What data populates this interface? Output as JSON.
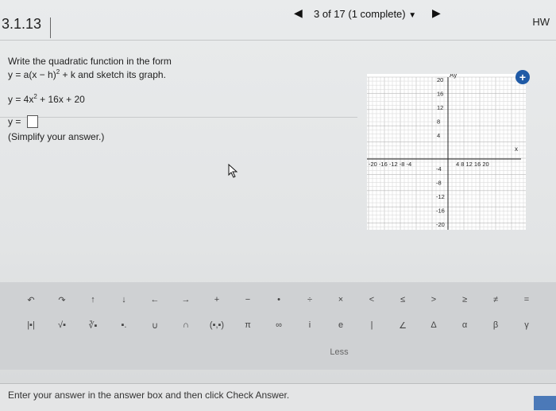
{
  "nav": {
    "prev_icon": "left-arrow",
    "status": "3 of 17 (1 complete)",
    "dropdown_icon": "triangle-down",
    "next_icon": "right-arrow",
    "hw": "HW"
  },
  "section_number": "3.1.13",
  "question": {
    "line1": "Write the quadratic function in the form",
    "line2_pre": "y = a(x − h)",
    "line2_sup": "2",
    "line2_post": " + k and sketch its graph.",
    "given_pre": "y = 4x",
    "given_sup": "2",
    "given_post": " + 16x + 20",
    "answer_prefix": "y =",
    "hint": "(Simplify your answer.)"
  },
  "graph": {
    "x_axis_label": "x",
    "y_axis_label": "Ay",
    "x_ticks_left": "-20 -16 -12 -8 -4",
    "x_ticks_right": "4 8 12 16 20",
    "y_ticks_pos": [
      "20",
      "16",
      "12",
      "8",
      "4"
    ],
    "y_ticks_neg": [
      "-4",
      "-8",
      "-12",
      "-16",
      "-20"
    ],
    "zoom_icon": "zoom-in-icon"
  },
  "toolbar": {
    "row1": [
      "↶",
      "↷",
      "↑",
      "↓",
      "←",
      "→",
      "+",
      "−",
      "•",
      "÷",
      "×",
      "<",
      "≤",
      ">",
      "≥",
      "≠",
      "="
    ],
    "row2": [
      "|▪|",
      "√▪",
      "∛▪",
      "▪.",
      "∪",
      "∩",
      "(▪,▪)",
      "π",
      "∞",
      "i",
      "e",
      "|",
      "∠",
      "Δ",
      "α",
      "β",
      "γ"
    ],
    "less_label": "Less"
  },
  "status_text": "Enter your answer in the answer box and then click Check Answer."
}
